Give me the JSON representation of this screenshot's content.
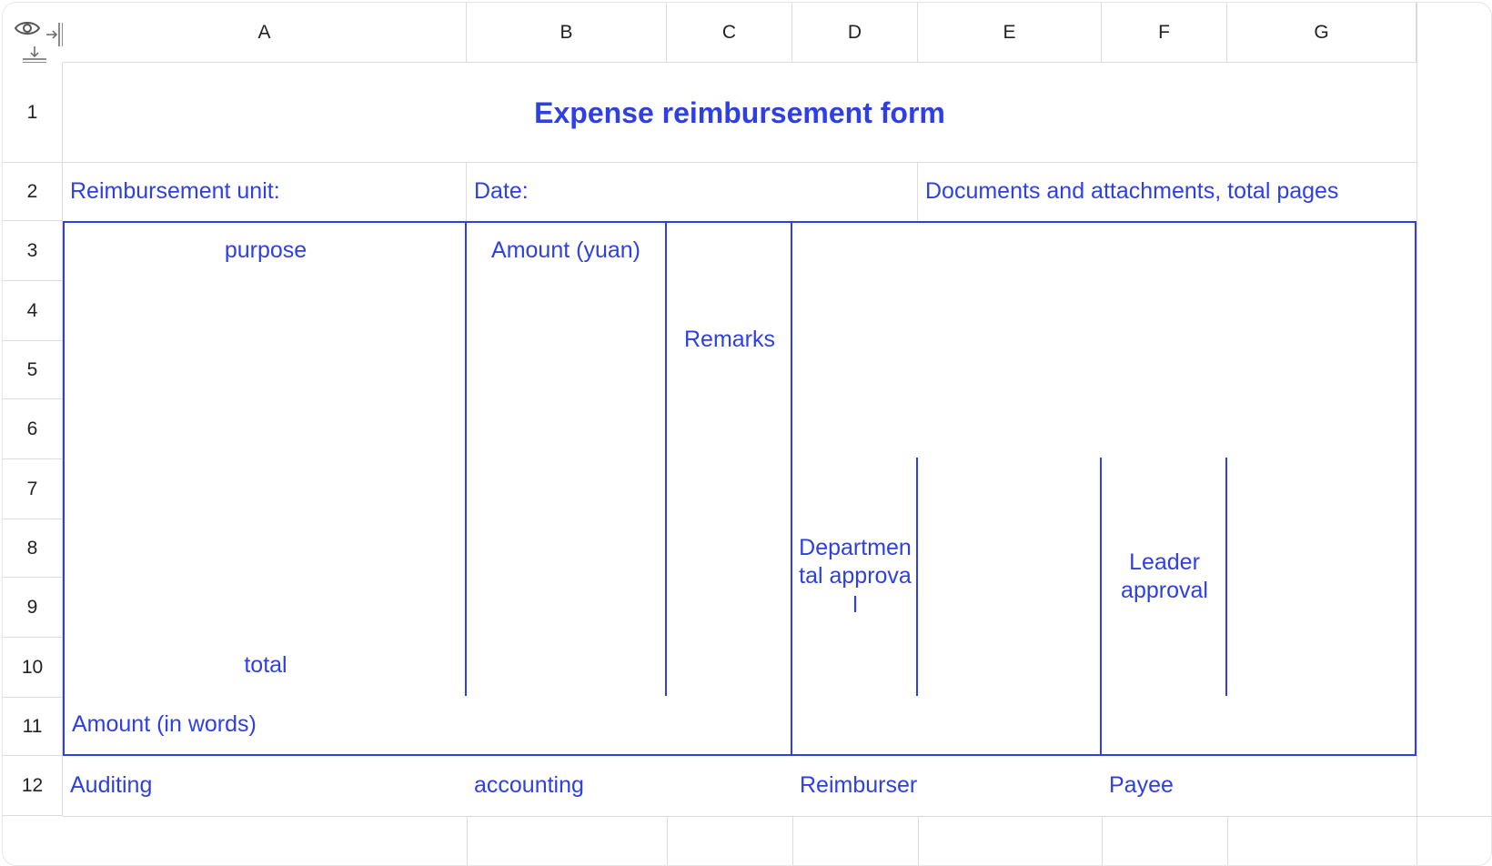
{
  "toolbar": {
    "eye_icon": "eye-icon",
    "collapse_columns_icon": "collapse-columns-icon",
    "collapse_rows_icon": "collapse-rows-icon"
  },
  "columns": [
    "A",
    "B",
    "C",
    "D",
    "E",
    "F",
    "G"
  ],
  "rows": [
    "1",
    "2",
    "3",
    "4",
    "5",
    "6",
    "7",
    "8",
    "9",
    "10",
    "11",
    "12"
  ],
  "form": {
    "title": "Expense reimbursement form",
    "reimbursement_unit": "Reimbursement unit:",
    "date": "Date:",
    "documents": "Documents and attachments, total pages",
    "purpose_header": "purpose",
    "amount_header": "Amount (yuan)",
    "remarks": "Remarks",
    "departmental_approval": "Departmental approval",
    "leader_approval": "Leader approval",
    "total": "total",
    "amount_words": "Amount (in words)",
    "auditing": "Auditing",
    "accounting": "accounting",
    "reimburser": "Reimburser",
    "payee": "Payee"
  },
  "colors": {
    "accent": "#2e3fe6",
    "grid": "#dcdcdc",
    "header_text": "#222222"
  }
}
